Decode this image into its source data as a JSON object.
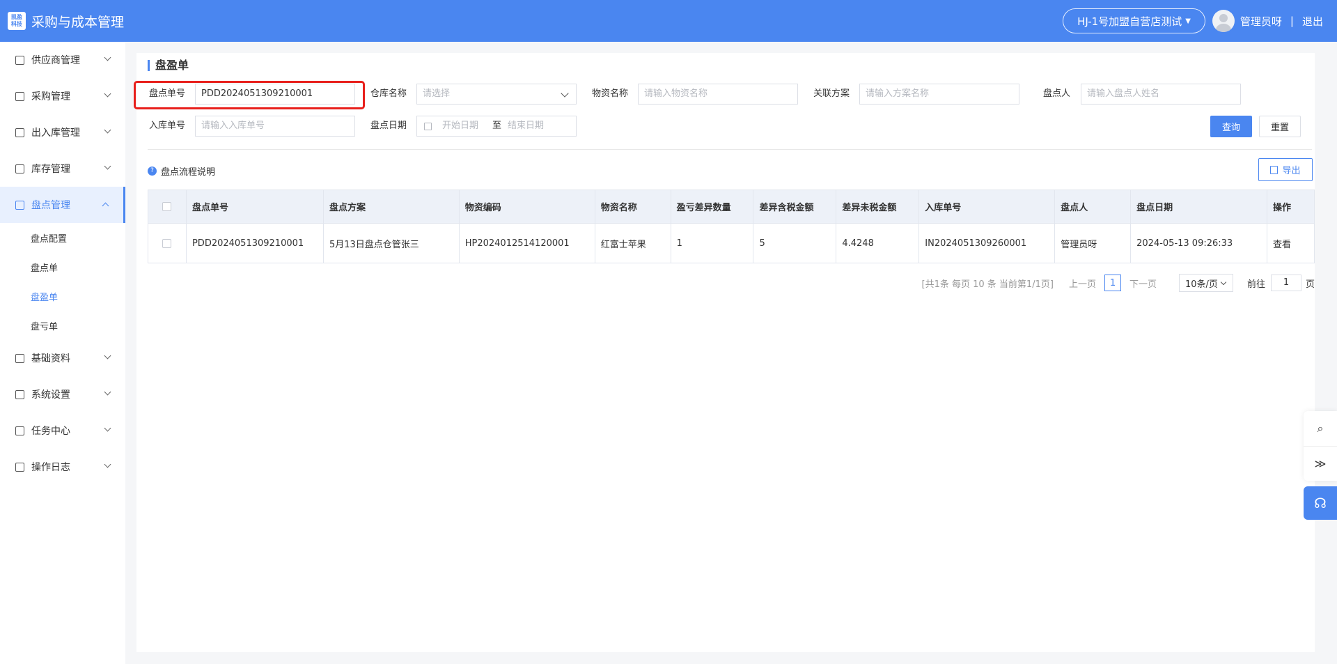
{
  "header": {
    "logo_line1": "凯盈",
    "logo_line2": "科技",
    "app_title": "采购与成本管理",
    "store": "HJ-1号加盟自营店测试",
    "username": "管理员呀",
    "separator": "|",
    "logout": "退出"
  },
  "sidebar": {
    "items": [
      {
        "label": "供应商管理",
        "icon": "supplier-icon"
      },
      {
        "label": "采购管理",
        "icon": "purchase-icon"
      },
      {
        "label": "出入库管理",
        "icon": "inout-icon"
      },
      {
        "label": "库存管理",
        "icon": "inventory-icon"
      },
      {
        "label": "盘点管理",
        "icon": "stocktake-icon"
      },
      {
        "label": "基础资料",
        "icon": "basic-data-icon"
      },
      {
        "label": "系统设置",
        "icon": "settings-icon"
      },
      {
        "label": "任务中心",
        "icon": "task-icon"
      },
      {
        "label": "操作日志",
        "icon": "log-icon"
      }
    ],
    "sub_items": [
      "盘点配置",
      "盘点单",
      "盘盈单",
      "盘亏单"
    ]
  },
  "page": {
    "title": "盘盈单"
  },
  "filters": {
    "stocktake_no_label": "盘点单号",
    "stocktake_no_value": "PDD2024051309210001",
    "warehouse_label": "仓库名称",
    "warehouse_placeholder": "请选择",
    "material_label": "物资名称",
    "material_placeholder": "请输入物资名称",
    "plan_label": "关联方案",
    "plan_placeholder": "请输入方案名称",
    "counter_label": "盘点人",
    "counter_placeholder": "请输入盘点人姓名",
    "inbound_no_label": "入库单号",
    "inbound_no_placeholder": "请输入入库单号",
    "date_label": "盘点日期",
    "date_start": "开始日期",
    "date_to": "至",
    "date_end": "结束日期",
    "query": "查询",
    "reset": "重置"
  },
  "toolbar": {
    "help": "盘点流程说明",
    "help_mark": "?",
    "export": "导出"
  },
  "table": {
    "headers": [
      "盘点单号",
      "盘点方案",
      "物资编码",
      "物资名称",
      "盈亏差异数量",
      "差异含税金额",
      "差异未税金额",
      "入库单号",
      "盘点人",
      "盘点日期",
      "操作"
    ],
    "rows": [
      [
        "PDD2024051309210001",
        "5月13日盘点仓管张三",
        "HP2024012514120001",
        "红富士苹果",
        "1",
        "5",
        "4.4248",
        "IN2024051309260001",
        "管理员呀",
        "2024-05-13 09:26:33",
        "查看"
      ]
    ]
  },
  "pagination": {
    "summary": "[共1条 每页 10 条 当前第1/1页]",
    "prev": "上一页",
    "current": "1",
    "next": "下一页",
    "page_size": "10条/页",
    "goto_label": "前往",
    "goto_value": "1",
    "page_unit": "页"
  },
  "float_tools": {
    "link": "⌕",
    "collapse": "≫",
    "support": "☊"
  },
  "colors": {
    "primary": "#4a86f0",
    "highlight": "#e8201c"
  }
}
